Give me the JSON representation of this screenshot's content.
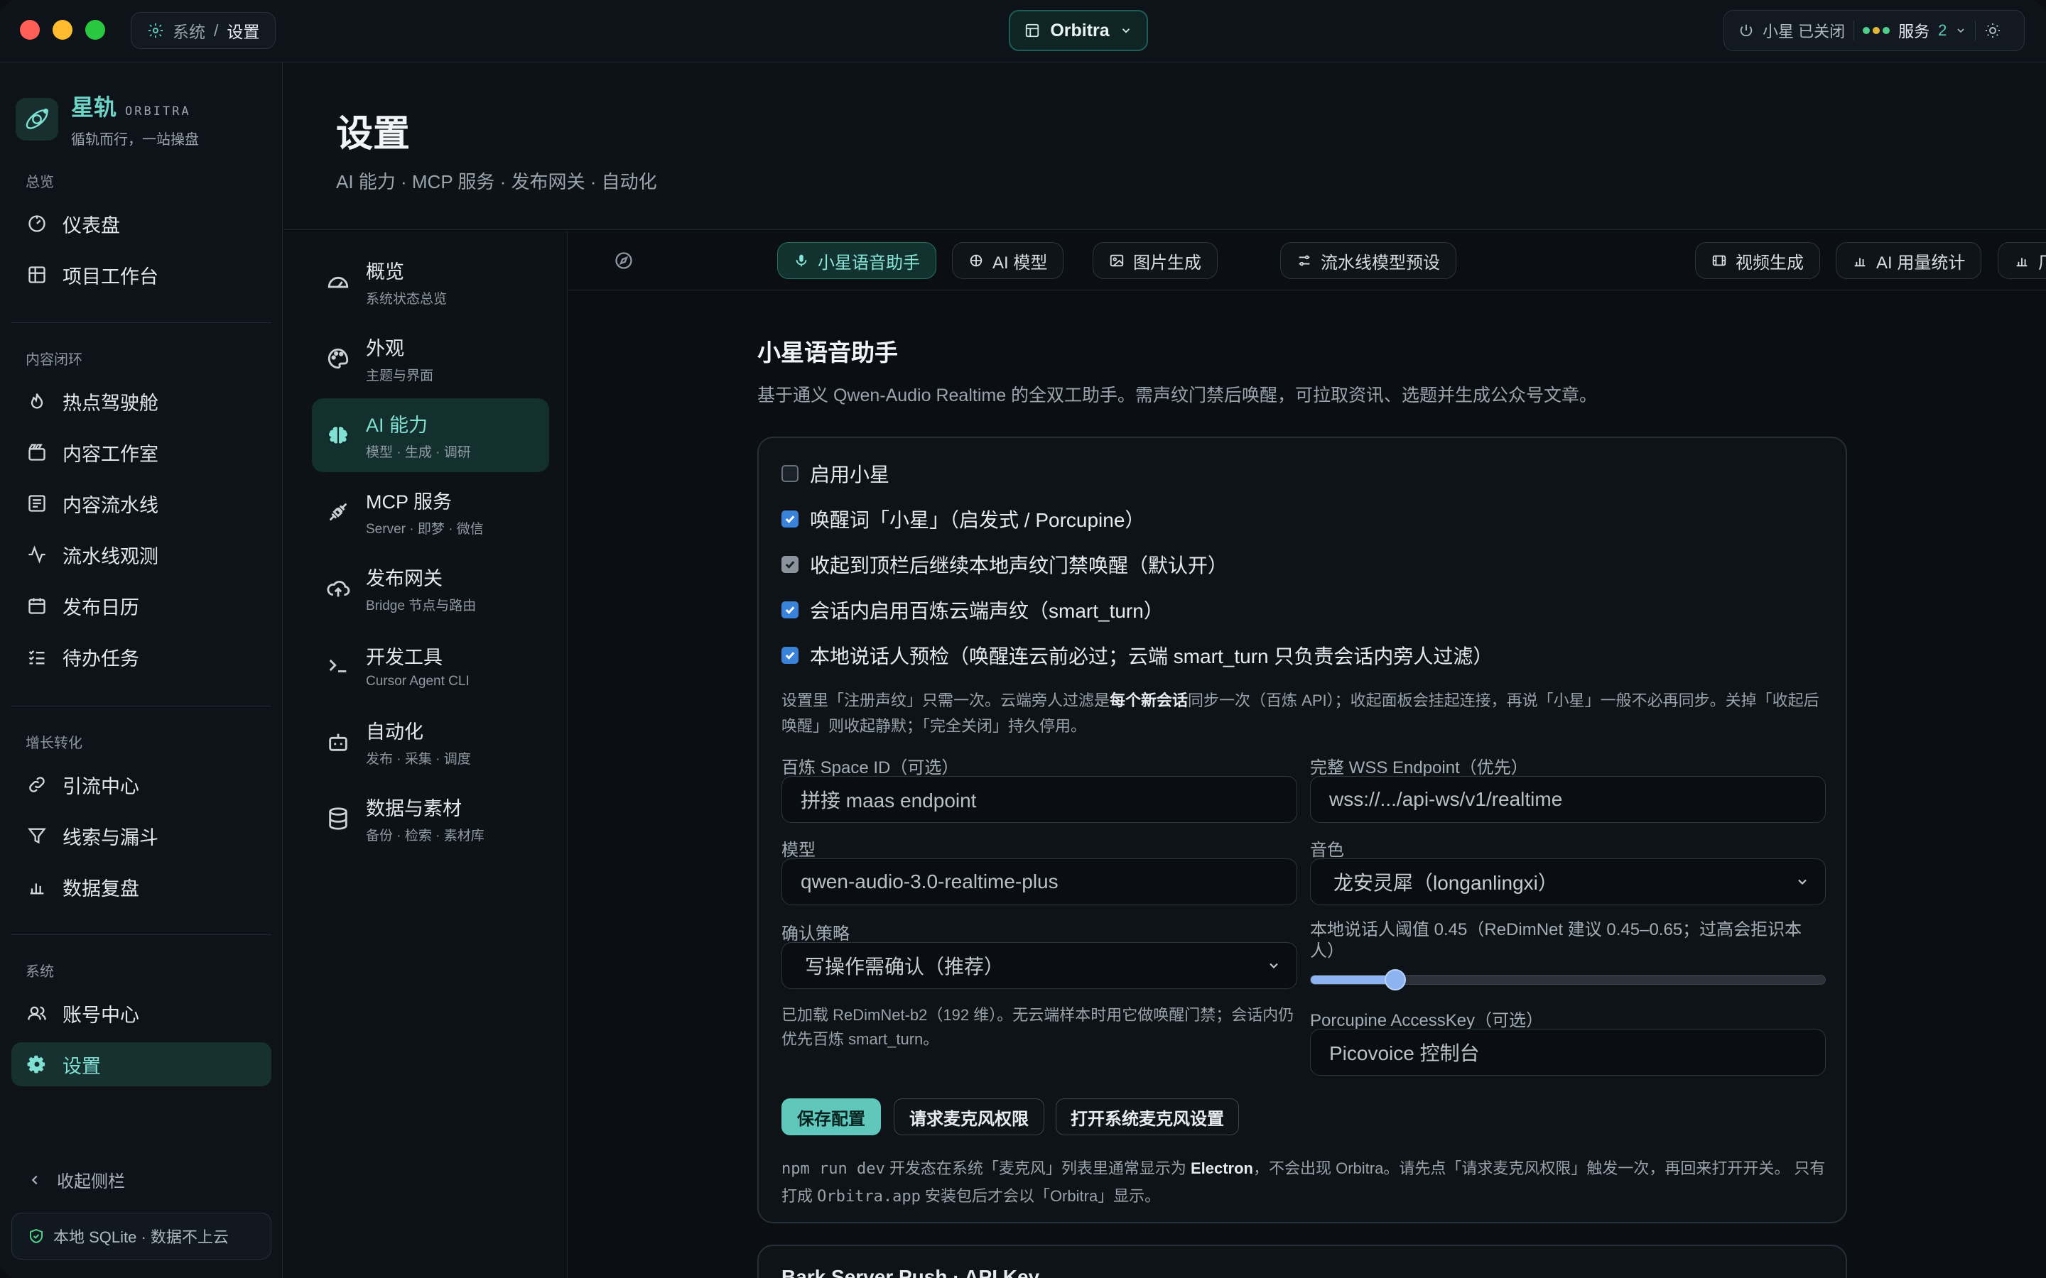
{
  "titlebar": {
    "breadcrumb_root": "系统",
    "breadcrumb_sep": "/",
    "breadcrumb_current": "设置",
    "workspace": "Orbitra",
    "assistant_status": "小星 已关闭",
    "services_label": "服务",
    "services_count": "2"
  },
  "brand": {
    "name": "星轨",
    "name_en": "ORBITRA",
    "tagline": "循轨而行，一站操盘"
  },
  "sidebar": {
    "sections": [
      "总览",
      "内容闭环",
      "增长转化",
      "系统"
    ],
    "overview_items": [
      "仪表盘",
      "项目工作台"
    ],
    "content_items": [
      "热点驾驶舱",
      "内容工作室",
      "内容流水线",
      "流水线观测",
      "发布日历",
      "待办任务"
    ],
    "growth_items": [
      "引流中心",
      "线索与漏斗",
      "数据复盘"
    ],
    "system_items": [
      "账号中心",
      "设置"
    ],
    "collapse_label": "收起侧栏",
    "storage_note": "本地 SQLite · 数据不上云"
  },
  "page": {
    "title": "设置",
    "subtitle": "AI 能力 · MCP 服务 · 发布网关 · 自动化"
  },
  "subnav": [
    {
      "title": "概览",
      "sub": "系统状态总览"
    },
    {
      "title": "外观",
      "sub": "主题与界面"
    },
    {
      "title": "AI 能力",
      "sub": "模型 · 生成 · 调研"
    },
    {
      "title": "MCP 服务",
      "sub": "Server · 即梦 · 微信"
    },
    {
      "title": "发布网关",
      "sub": "Bridge 节点与路由"
    },
    {
      "title": "开发工具",
      "sub": "Cursor Agent CLI"
    },
    {
      "title": "自动化",
      "sub": "发布 · 采集 · 调度"
    },
    {
      "title": "数据与素材",
      "sub": "备份 · 检索 · 素材库"
    }
  ],
  "tabs": [
    "小星语音助手",
    "AI 模型",
    "图片生成",
    "流水线模型预设",
    "视频生成",
    "AI 用量统计",
    "厂商用量对"
  ],
  "voice": {
    "title": "小星语音助手",
    "desc": "基于通义 Qwen-Audio Realtime 的全双工助手。需声纹门禁后唤醒，可拉取资讯、选题并生成公众号文章。",
    "checks": [
      {
        "label": "启用小星",
        "checked": false
      },
      {
        "label": "唤醒词「小星」（启发式 / Porcupine）",
        "checked": true
      },
      {
        "label": "收起到顶栏后继续本地声纹门禁唤醒（默认开）",
        "checked": true
      },
      {
        "label": "会话内启用百炼云端声纹（smart_turn）",
        "checked": true
      },
      {
        "label": "本地说话人预检（唤醒连云前必过；云端 smart_turn 只负责会话内旁人过滤）",
        "checked": true
      }
    ],
    "note_a": "设置里「注册声纹」只需一次。云端旁人过滤是",
    "note_bold": "每个新会话",
    "note_b": "同步一次（百炼 API）；收起面板会挂起连接，再说「小星」一般不必再同步。关掉「收起后",
    "note_c": "唤醒」则收起静默；「完全关闭」持久停用。",
    "space_id_label": "百炼 Space ID（可选）",
    "space_id_placeholder": "拼接 maas endpoint",
    "wss_label": "完整 WSS Endpoint（优先）",
    "wss_placeholder": "wss://.../api-ws/v1/realtime",
    "model_label": "模型",
    "model_value": "qwen-audio-3.0-realtime-plus",
    "voice_label": "音色",
    "voice_value": "龙安灵犀（longanlingxi）",
    "policy_label": "确认策略",
    "policy_value": "写操作需确认（推荐）",
    "threshold_label_a": "本地说话人阈值 0.45（ReDimNet 建议 0.45–0.65；过高会拒识本",
    "threshold_label_b": "人）",
    "threshold_value": 0.45,
    "threshold_min": 0,
    "threshold_max": 1,
    "loaded_note_a": "已加载 ReDimNet-b2（192 维）。无云端样本时用它做唤醒门禁；会话内仍",
    "loaded_note_b": "优先百炼 smart_turn。",
    "porcupine_label": "Porcupine AccessKey（可选）",
    "porcupine_placeholder": "Picovoice 控制台",
    "btn_save": "保存配置",
    "btn_mic": "请求麦克风权限",
    "btn_sys": "打开系统麦克风设置",
    "footer_cmd": "npm run dev",
    "footer_a": " 开发态在系统「麦克风」列表里通常显示为 ",
    "footer_bold": "Electron",
    "footer_b": "，不会出现 Orbitra。请先点「请求麦克风权限」触发一次，再回来打开开关。 只有",
    "footer_c1": "打成 ",
    "footer_app": "Orbitra.app",
    "footer_c2": " 安装包后才会以「Orbitra」显示。",
    "next_card_title": "Bark Server Push · API Key"
  },
  "colors": {
    "accent": "#5fc7bc",
    "checkbox": "#3b82d9",
    "traffic_red": "#ff5f57",
    "traffic_yellow": "#febc2e",
    "traffic_green": "#28c840"
  }
}
